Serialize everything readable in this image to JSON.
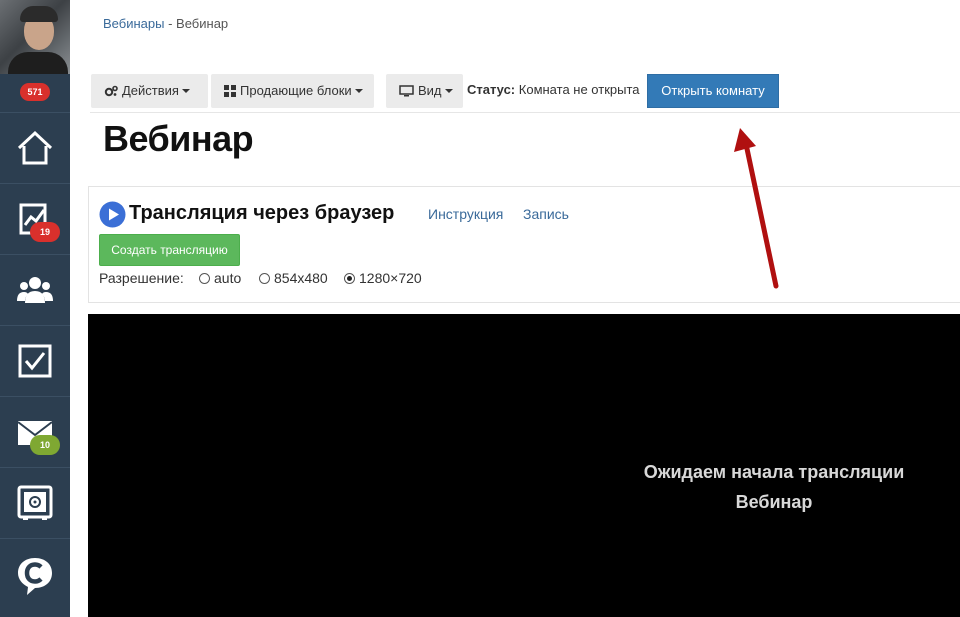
{
  "sidebar": {
    "profile_badge": "571",
    "items": [
      {
        "icon": "home-icon"
      },
      {
        "icon": "chart-icon",
        "badge": "19",
        "badge_color": "#d9302c"
      },
      {
        "icon": "users-icon"
      },
      {
        "icon": "tasks-icon"
      },
      {
        "icon": "mail-icon",
        "badge": "10",
        "badge_color": "#7fa832"
      },
      {
        "icon": "safe-icon"
      },
      {
        "icon": "chat-logo-icon"
      }
    ]
  },
  "breadcrumb": {
    "parent": "Вебинары",
    "separator": "-",
    "current": "Вебинар"
  },
  "toolbar": {
    "actions_label": "Действия",
    "blocks_label": "Продающие блоки",
    "view_label": "Вид",
    "status_label": "Статус:",
    "status_value": "Комната не открыта",
    "open_room_label": "Открыть комнату"
  },
  "page": {
    "title": "Вебинар"
  },
  "broadcast": {
    "title": "Трансляция через браузер",
    "instruction_link": "Инструкция",
    "record_link": "Запись",
    "create_button": "Создать трансляцию",
    "resolution_label": "Разрешение:",
    "resolutions": [
      "auto",
      "854x480",
      "1280×720"
    ],
    "selected_resolution": "1280×720"
  },
  "video": {
    "waiting_line1": "Ожидаем начала трансляции",
    "waiting_line2": "Вебинар"
  },
  "colors": {
    "sidebar": "#2c3e50",
    "primary_button": "#337ab7",
    "success_button": "#5cb85c",
    "link": "#3a6a9a",
    "annotation_arrow": "#b01010"
  }
}
